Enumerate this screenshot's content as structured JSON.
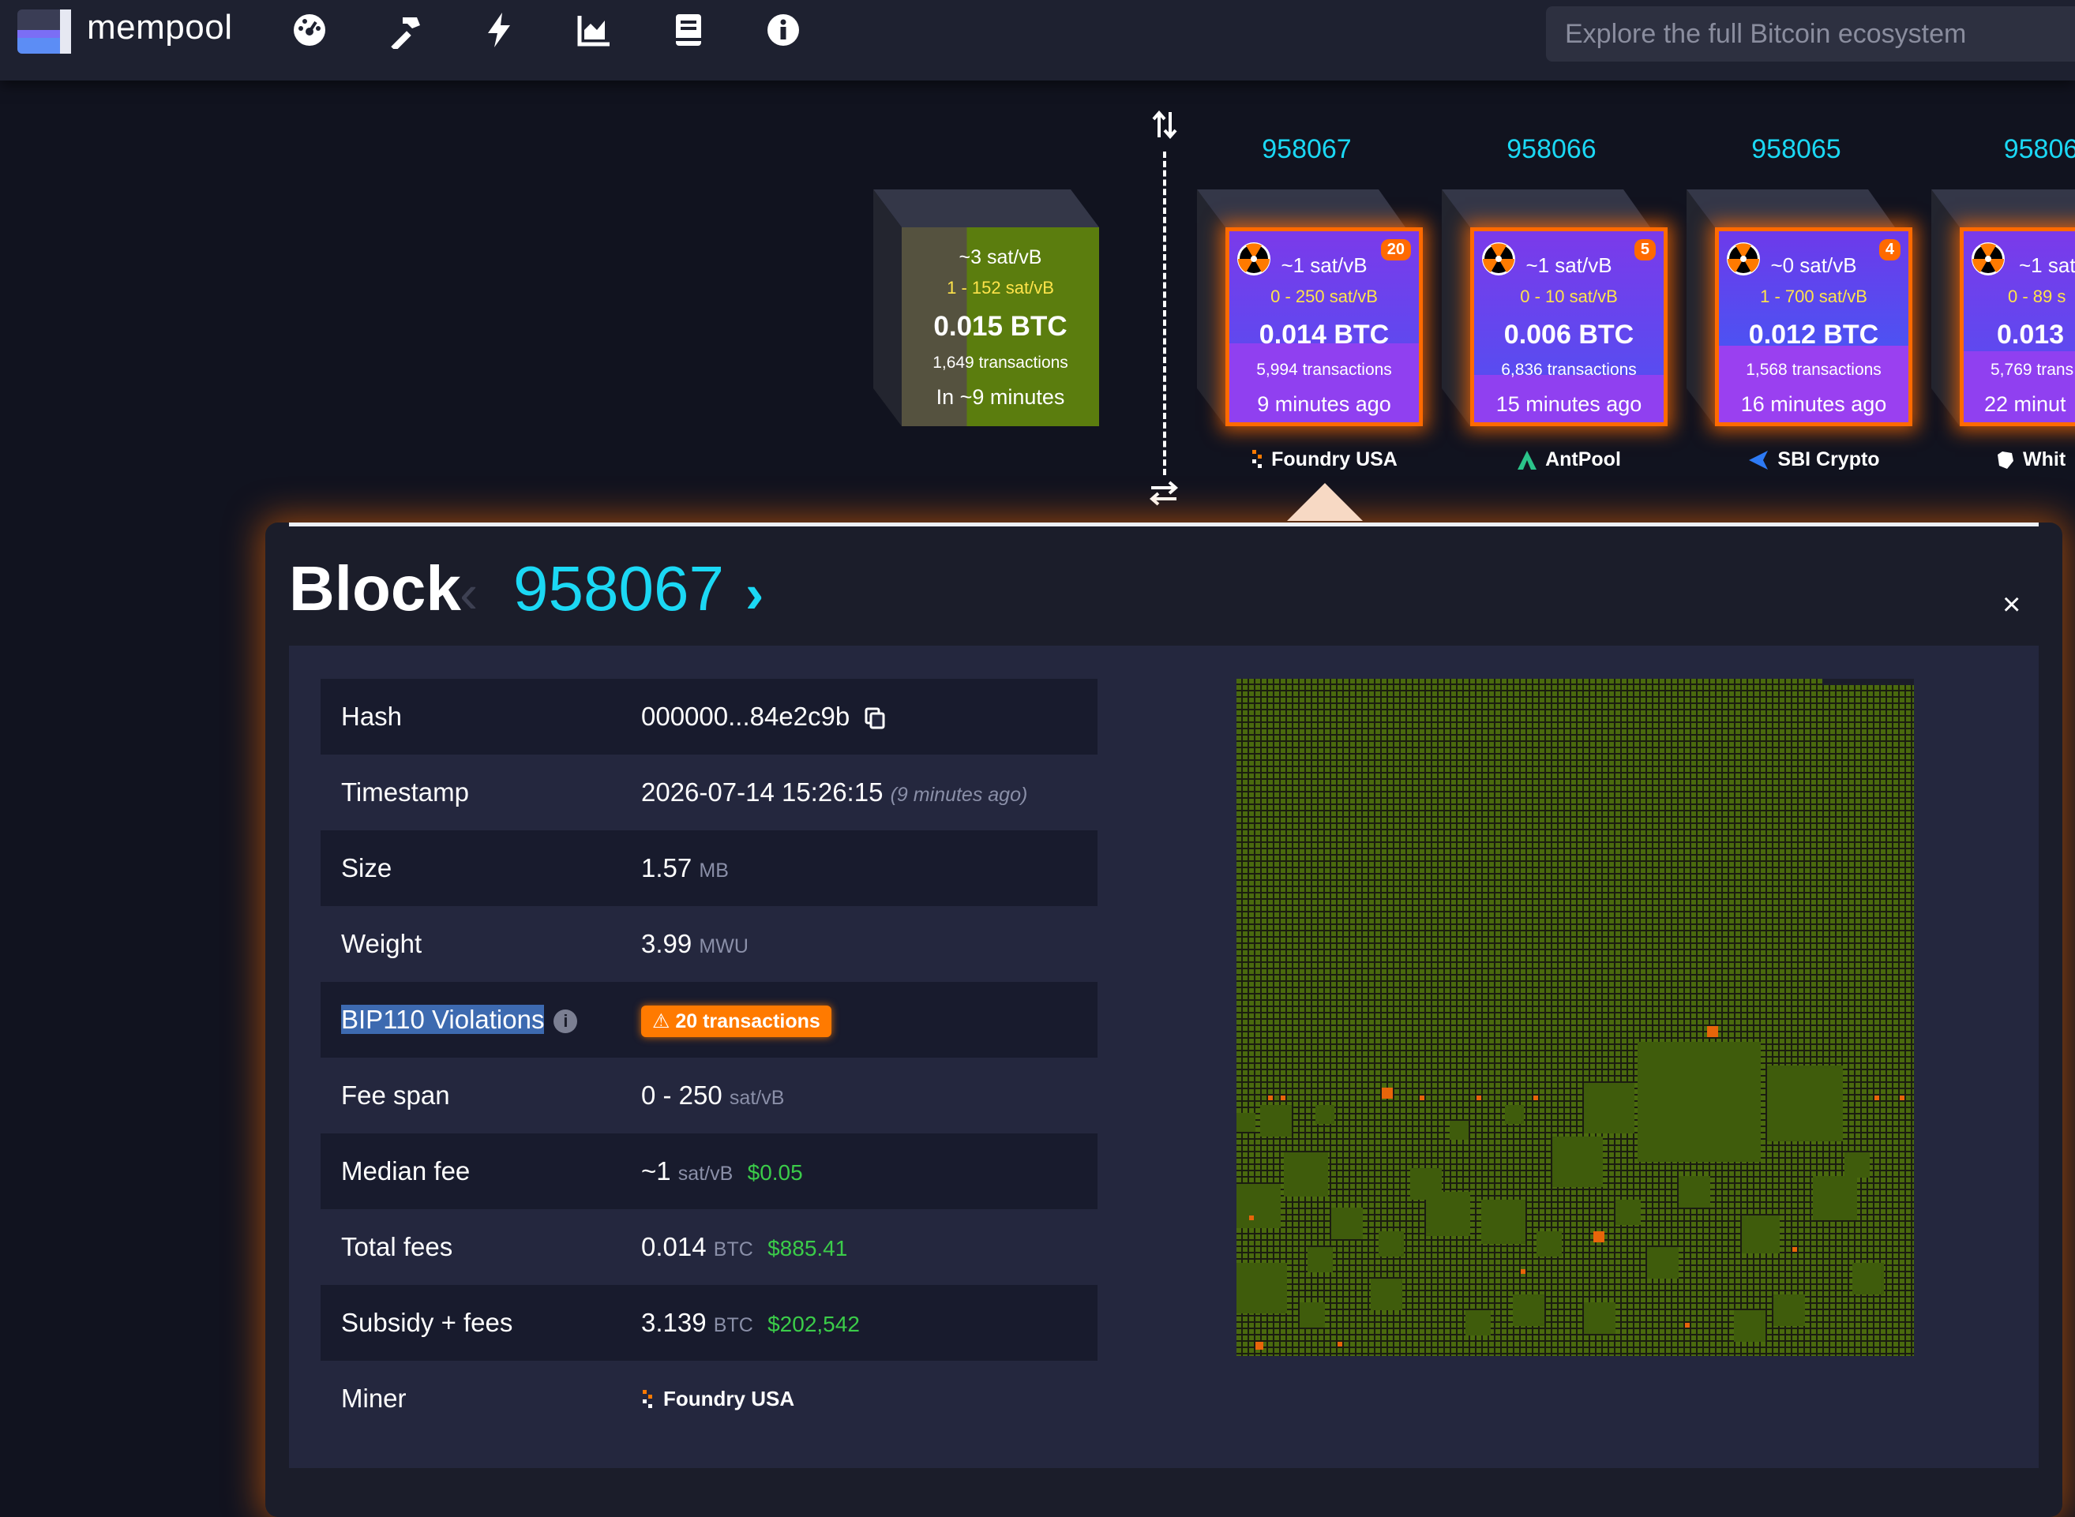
{
  "header": {
    "logo_text": "mempool",
    "nav_icons": [
      "dashboard-icon",
      "mining-icon",
      "lightning-icon",
      "graphs-icon",
      "docs-icon",
      "about-icon"
    ],
    "search_placeholder": "Explore the full Bitcoin ecosystem"
  },
  "pending_block": {
    "median_fee": "~3 sat/vB",
    "fee_range": "1 - 152 sat/vB",
    "total": "0.015 BTC",
    "tx_count": "1,649 transactions",
    "eta": "In ~9 minutes"
  },
  "mined_blocks": [
    {
      "height": "958067",
      "median_fee": "~1 sat/vB",
      "fee_range": "0 - 250 sat/vB",
      "total": "0.014 BTC",
      "tx_count": "5,994 transactions",
      "time": "9 minutes ago",
      "badge": "20",
      "pool": "Foundry USA"
    },
    {
      "height": "958066",
      "median_fee": "~1 sat/vB",
      "fee_range": "0 - 10 sat/vB",
      "total": "0.006 BTC",
      "tx_count": "6,836 transactions",
      "time": "15 minutes ago",
      "badge": "5",
      "pool": "AntPool"
    },
    {
      "height": "958065",
      "median_fee": "~0 sat/vB",
      "fee_range": "1 - 700 sat/vB",
      "total": "0.012 BTC",
      "tx_count": "1,568 transactions",
      "time": "16 minutes ago",
      "badge": "4",
      "pool": "SBI Crypto"
    },
    {
      "height": "95806",
      "median_fee": "~1 sat",
      "fee_range": "0 - 89 s",
      "total": "0.013",
      "tx_count": "5,769 trans",
      "time": "22 minut",
      "badge": "",
      "pool": "Whit"
    }
  ],
  "block": {
    "title": "Block",
    "prev_arrow": "‹",
    "number": "958067",
    "next_arrow": "›",
    "close": "×",
    "rows": {
      "hash": {
        "label": "Hash",
        "value": "000000...84e2c9b"
      },
      "timestamp": {
        "label": "Timestamp",
        "value": "2026-07-14 15:26:15",
        "relative": "(9 minutes ago)"
      },
      "size": {
        "label": "Size",
        "value": "1.57",
        "unit": "MB"
      },
      "weight": {
        "label": "Weight",
        "value": "3.99",
        "unit": "MWU"
      },
      "bip110": {
        "label": "BIP110 Violations",
        "value": "⚠ 20 transactions"
      },
      "fee_span": {
        "label": "Fee span",
        "value": "0 - 250",
        "unit": "sat/vB"
      },
      "median_fee": {
        "label": "Median fee",
        "value": "~1",
        "unit": "sat/vB",
        "fiat": "$0.05"
      },
      "total_fees": {
        "label": "Total fees",
        "value": "0.014",
        "unit": "BTC",
        "fiat": "$885.41"
      },
      "subsidy": {
        "label": "Subsidy + fees",
        "value": "3.139",
        "unit": "BTC",
        "fiat": "$202,542"
      },
      "miner": {
        "label": "Miner",
        "value": "Foundry USA"
      }
    }
  },
  "colors": {
    "accent": "#1bd8f4",
    "warning": "#ff7a00",
    "fiat": "#3bcc49",
    "tx_green": "#4a6a0e",
    "tx_orange": "#e8650a"
  }
}
